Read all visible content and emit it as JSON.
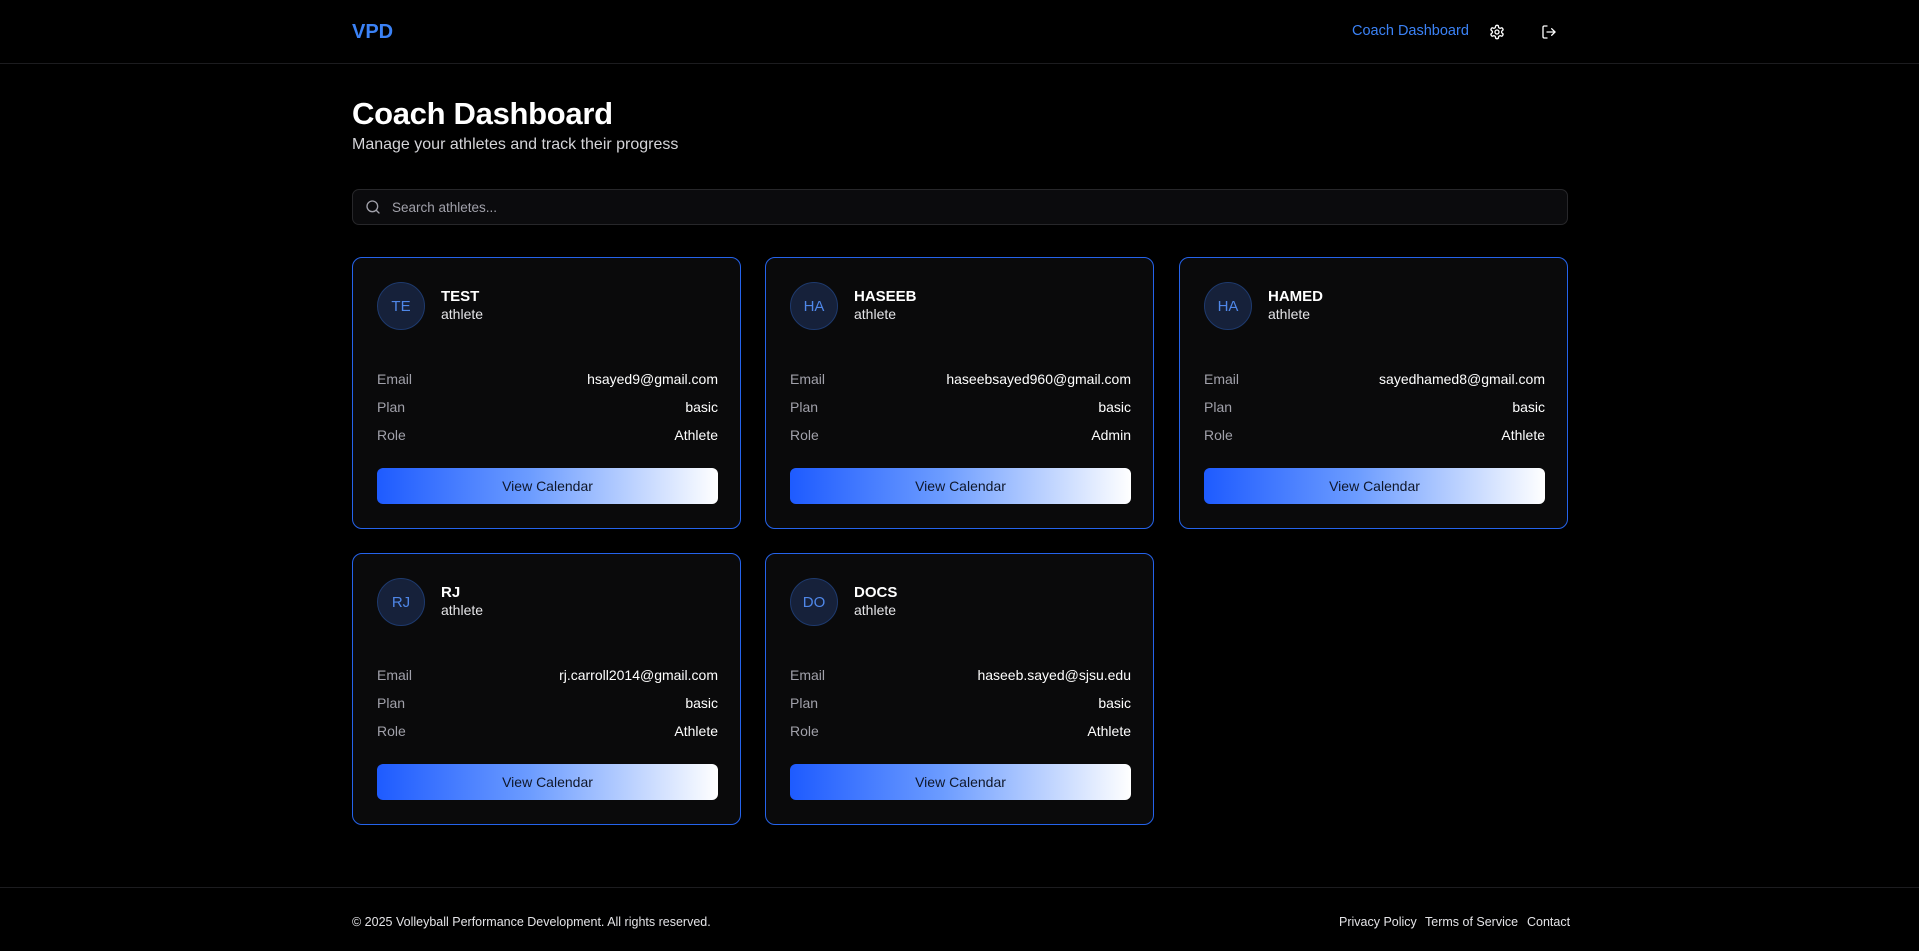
{
  "header": {
    "logo": "VPD",
    "nav_link": "Coach Dashboard",
    "icons": [
      "gear-icon",
      "logout-icon"
    ]
  },
  "page": {
    "title": "Coach Dashboard",
    "subtitle": "Manage your athletes and track their progress"
  },
  "search": {
    "placeholder": "Search athletes...",
    "value": ""
  },
  "labels": {
    "email": "Email",
    "plan": "Plan",
    "role": "Role",
    "button": "View Calendar"
  },
  "athletes": [
    {
      "initials": "TE",
      "name": "TEST",
      "type": "athlete",
      "email": "hsayed9@gmail.com",
      "plan": "basic",
      "role": "Athlete"
    },
    {
      "initials": "HA",
      "name": "HASEEB",
      "type": "athlete",
      "email": "haseebsayed960@gmail.com",
      "plan": "basic",
      "role": "Admin"
    },
    {
      "initials": "HA",
      "name": "HAMED",
      "type": "athlete",
      "email": "sayedhamed8@gmail.com",
      "plan": "basic",
      "role": "Athlete"
    },
    {
      "initials": "RJ",
      "name": "RJ",
      "type": "athlete",
      "email": "rj.carroll2014@gmail.com",
      "plan": "basic",
      "role": "Athlete"
    },
    {
      "initials": "DO",
      "name": "DOCS",
      "type": "athlete",
      "email": "haseeb.sayed@sjsu.edu",
      "plan": "basic",
      "role": "Athlete"
    }
  ],
  "footer": {
    "copyright": "© 2025 Volleyball Performance Development. All rights reserved.",
    "links": [
      "Privacy Policy",
      "Terms of Service",
      "Contact"
    ]
  },
  "colors": {
    "accent": "#3b82f6",
    "card_border": "#2563eb",
    "background": "#000000"
  }
}
